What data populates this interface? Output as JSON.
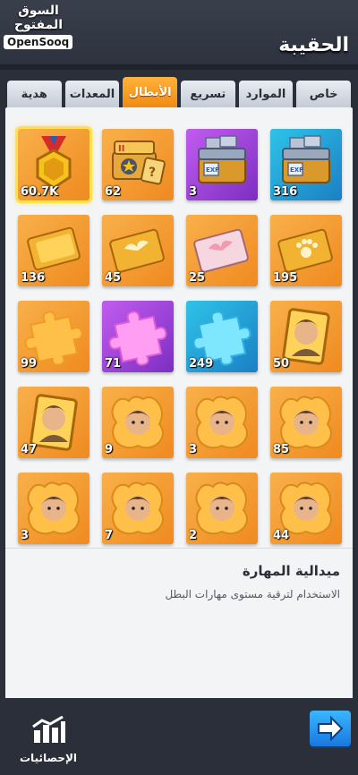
{
  "watermark": {
    "arabic": "السوق المفتوح",
    "latin": "OpenSooq"
  },
  "screen": {
    "title": "الحقيبة"
  },
  "tabs": [
    {
      "label": "خاص",
      "active": false
    },
    {
      "label": "الموارد",
      "active": false
    },
    {
      "label": "تسريع",
      "active": false
    },
    {
      "label": "الأبطال",
      "active": true
    },
    {
      "label": "المعدات",
      "active": false
    },
    {
      "label": "هدية",
      "active": false
    }
  ],
  "items": [
    {
      "count": "60.7K",
      "icon": "skill-medal-icon",
      "bg": "orange",
      "selected": true
    },
    {
      "count": "62",
      "icon": "hero-ticket-chest-icon",
      "bg": "orange",
      "selected": false
    },
    {
      "count": "3",
      "icon": "exp-chest-icon",
      "bg": "purple",
      "selected": false
    },
    {
      "count": "316",
      "icon": "exp-chest-icon",
      "bg": "blue",
      "selected": false
    },
    {
      "count": "136",
      "icon": "gold-card-icon",
      "bg": "orange",
      "selected": false
    },
    {
      "count": "45",
      "icon": "winged-card-gold-icon",
      "bg": "orange",
      "selected": false
    },
    {
      "count": "25",
      "icon": "winged-card-pink-icon",
      "bg": "orange",
      "selected": false
    },
    {
      "count": "195",
      "icon": "paw-card-icon",
      "bg": "orange",
      "selected": false
    },
    {
      "count": "99",
      "icon": "puzzle-orange-icon",
      "bg": "orange",
      "selected": false
    },
    {
      "count": "71",
      "icon": "puzzle-pink-icon",
      "bg": "purple",
      "selected": false
    },
    {
      "count": "249",
      "icon": "puzzle-blue-icon",
      "bg": "blue",
      "selected": false
    },
    {
      "count": "50",
      "icon": "hero-card-icon",
      "bg": "orange",
      "selected": false
    },
    {
      "count": "47",
      "icon": "hero-card-icon",
      "bg": "orange",
      "selected": false
    },
    {
      "count": "9",
      "icon": "hero-shard-icon",
      "bg": "orange",
      "selected": false
    },
    {
      "count": "3",
      "icon": "hero-shard-icon",
      "bg": "orange",
      "selected": false
    },
    {
      "count": "85",
      "icon": "hero-shard-icon",
      "bg": "orange",
      "selected": false
    },
    {
      "count": "3",
      "icon": "hero-shard-icon",
      "bg": "orange",
      "selected": false
    },
    {
      "count": "7",
      "icon": "hero-shard-icon",
      "bg": "orange",
      "selected": false
    },
    {
      "count": "2",
      "icon": "hero-shard-icon",
      "bg": "orange",
      "selected": false
    },
    {
      "count": "44",
      "icon": "hero-shard-icon",
      "bg": "orange",
      "selected": false
    }
  ],
  "description": {
    "title": "ميدالية المهارة",
    "text": "الاستخدام لترقية مستوى مهارات البطل"
  },
  "footer": {
    "stats_label": "الإحصائيات"
  },
  "colors": {
    "accent": "#f08a12",
    "selected_outline": "#ffe24a",
    "next_button": "#1878e0"
  }
}
